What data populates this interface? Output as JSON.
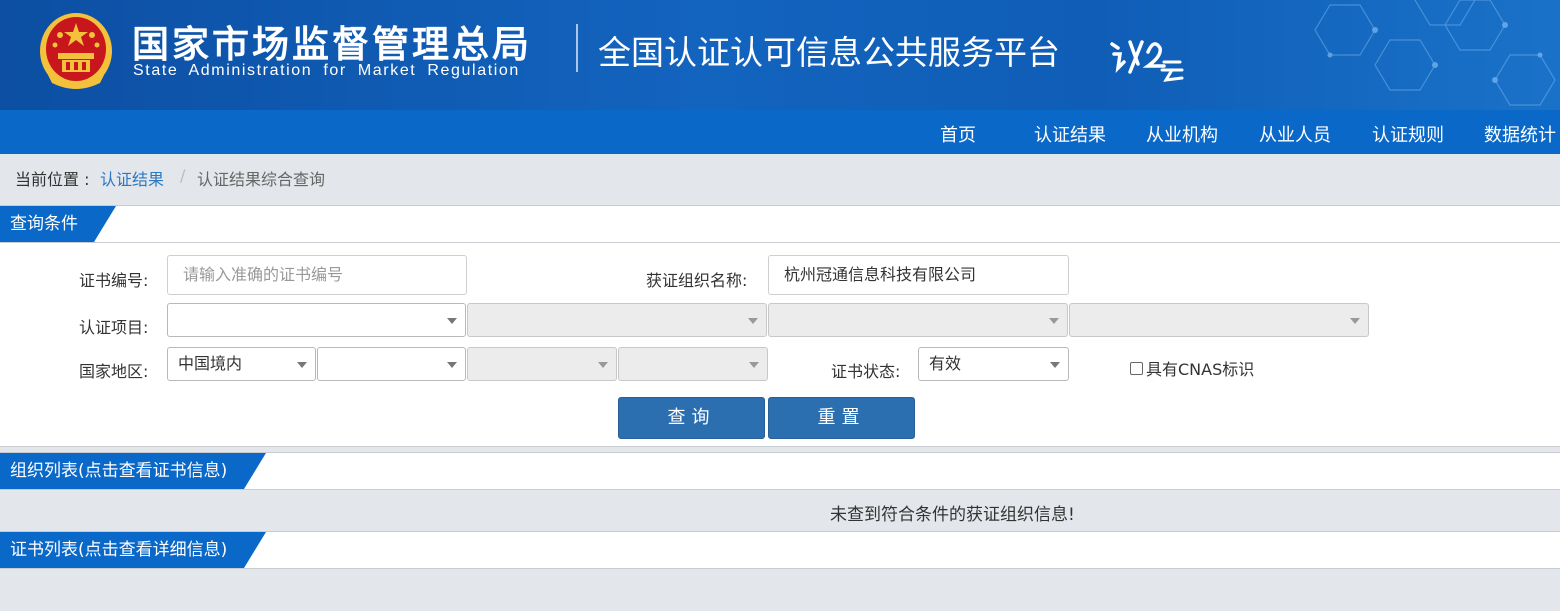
{
  "header": {
    "agency_cn": "国家市场监督管理总局",
    "agency_en": "State Administration  for  Market Regulation",
    "platform_name": "全国认证认可信息公共服务平台",
    "colors": {
      "banner": "#0c4fa3",
      "nav": "#0a68c9",
      "accent_red": "#c8161d",
      "gold": "#f4c13d"
    }
  },
  "nav": {
    "items": [
      "首页",
      "认证结果",
      "从业机构",
      "从业人员",
      "认证规则",
      "数据统计"
    ]
  },
  "breadcrumb": {
    "prefix": "当前位置 :",
    "link": "认证结果",
    "separator": "/",
    "current": "认证结果综合查询"
  },
  "query_section": {
    "title": "查询条件",
    "cert_no_label": "证书编号:",
    "cert_no_placeholder": "请输入准确的证书编号",
    "org_name_label": "获证组织名称:",
    "org_name_value": "杭州冠通信息科技有限公司",
    "project_label": "认证项目:",
    "region_label": "国家地区:",
    "region_value": "中国境内",
    "status_label": "证书状态:",
    "status_value": "有效",
    "cnas_label": "具有CNAS标识",
    "query_button": "查询",
    "reset_button": "重置"
  },
  "org_list": {
    "title": "组织列表(点击查看证书信息)",
    "empty_message": "未查到符合条件的获证组织信息!"
  },
  "cert_list": {
    "title": "证书列表(点击查看详细信息)"
  }
}
